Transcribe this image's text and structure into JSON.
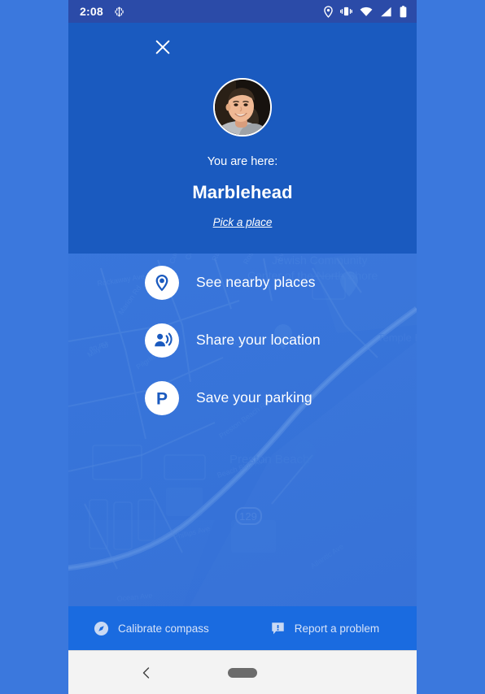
{
  "status_bar": {
    "time": "2:08",
    "left_icons": [
      "dna-sync-icon"
    ],
    "right_icons": [
      "location-pin-icon",
      "vibrate-icon",
      "wifi-icon",
      "cellular-signal-icon",
      "battery-icon"
    ]
  },
  "header": {
    "close_label": "close-icon",
    "avatar_alt": "User profile photo",
    "subtitle": "You are here:",
    "place_name": "Marblehead",
    "link_label": "Pick a place",
    "background_color": "#1a5abf"
  },
  "actions": [
    {
      "id": "see-nearby-places",
      "icon": "place-pin-icon",
      "label": "See nearby places"
    },
    {
      "id": "share-your-location",
      "icon": "share-location-icon",
      "label": "Share your location"
    },
    {
      "id": "save-your-parking",
      "icon": "parking-icon",
      "label": "Save your parking"
    }
  ],
  "bottom_bar": {
    "calibrate": {
      "icon": "compass-icon",
      "label": "Calibrate compass"
    },
    "report": {
      "icon": "report-problem-icon",
      "label": "Report a problem"
    },
    "background_color": "#1a6be0"
  },
  "map": {
    "labels": [
      "Jewish Community",
      "Center of the North Shore",
      "Temple Emanu-El",
      "Clifton",
      "Preston Beach",
      "Beach Bluff Ave",
      "Phillips Ave",
      "Pilgrim Rd",
      "May St",
      "Marion Rd",
      "Curtis St",
      "Rose Ave",
      "Evans Rd",
      "Rams Ln",
      "Clifton Ave",
      "Rockaway Ave",
      "Preston Beach Rd",
      "Atlantic Ave",
      "Ocean Ave"
    ],
    "route_shield": "129",
    "background_color": "#3b78dd"
  },
  "nav_bar": {
    "back_icon": "chevron-left-icon",
    "home_pill": "home-gesture-pill"
  },
  "colors": {
    "page_background": "#3b78dd",
    "status_bar": "#2b4ba8",
    "accent_blue": "#1a5abf",
    "icon_blue": "#1a5abf",
    "nav_bar": "#f3f3f3"
  }
}
